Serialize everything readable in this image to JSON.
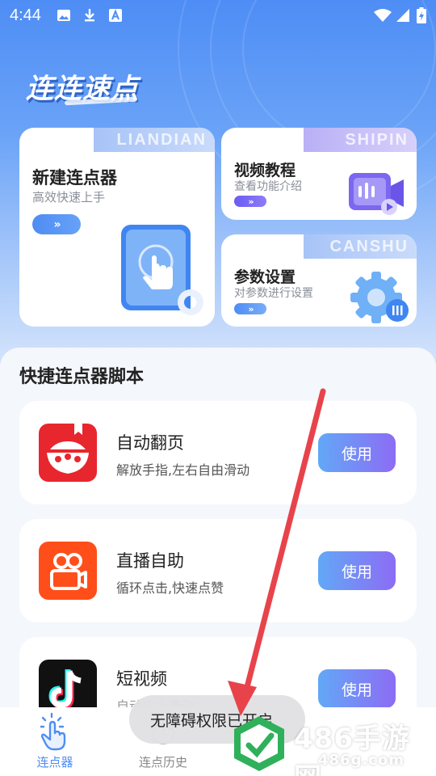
{
  "status_bar": {
    "time": "4:44",
    "icons": [
      "image-icon",
      "download-icon",
      "font-icon",
      "wifi-icon",
      "signal-icon",
      "battery-icon"
    ]
  },
  "app_title": "连连速点",
  "cards": {
    "new_clicker": {
      "tab_text": "LIANDIAN",
      "title": "新建连点器",
      "subtitle": "高效快速上手",
      "arrow": "»",
      "icon": "tap-hand-icon"
    },
    "video_tutorial": {
      "tab_text": "SHIPIN",
      "title": "视频教程",
      "subtitle": "查看功能介绍",
      "arrow": "»",
      "icon": "video-icon"
    },
    "param_settings": {
      "tab_text": "CANSHU",
      "title": "参数设置",
      "subtitle": "对参数进行设置",
      "arrow": "»",
      "icon": "settings-gear-icon"
    }
  },
  "scripts_section": {
    "title": "快捷连点器脚本",
    "items": [
      {
        "name": "自动翻页",
        "desc": "解放手指,左右自由滑动",
        "button": "使用",
        "icon": "book-app-icon"
      },
      {
        "name": "直播自助",
        "desc": "循环点击,快速点赞",
        "button": "使用",
        "icon": "kuaishou-app-icon"
      },
      {
        "name": "短视频",
        "desc": "自动向上滑动",
        "button": "使用",
        "icon": "tiktok-app-icon"
      }
    ]
  },
  "bottom_nav": {
    "items": [
      {
        "label": "连点器",
        "active": true,
        "icon": "tap-hand-icon"
      },
      {
        "label": "连点历史",
        "active": false,
        "icon": "history-icon"
      }
    ]
  },
  "toast": "无障碍权限已开启",
  "watermark": {
    "text": "486手游网",
    "sub": "486g.com"
  },
  "colors": {
    "primary_blue": "#4e8df5",
    "purple": "#8c6cf4",
    "annotation_arrow": "#e8434b",
    "watermark_green": "#2fb05a"
  }
}
